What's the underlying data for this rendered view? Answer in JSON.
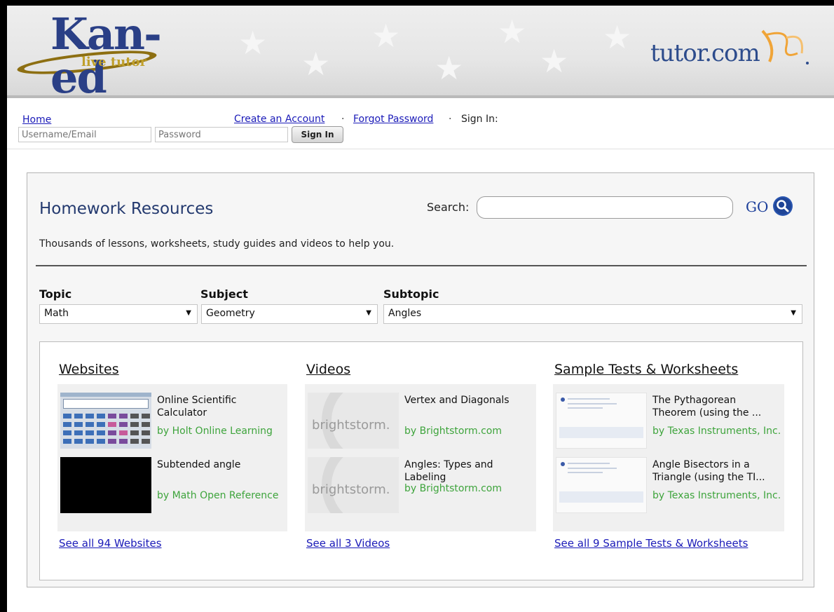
{
  "header": {
    "kaned_logo_text": "Kan-ed",
    "kaned_logo_sub": "live tutor",
    "tutor_logo_text": "tutor.com"
  },
  "login": {
    "home": "Home",
    "create_account": "Create an Account",
    "separator": "·",
    "forgot_password": "Forgot Password",
    "sign_in_label": "Sign In:",
    "username_placeholder": "Username/Email",
    "password_placeholder": "Password",
    "sign_in_button": "Sign In"
  },
  "homework": {
    "title": "Homework Resources",
    "description": "Thousands of lessons, worksheets, study guides and videos to help you.",
    "search_label": "Search:",
    "search_value": "",
    "go_label": "GO",
    "filters": {
      "topic_label": "Topic",
      "topic_value": "Math",
      "subject_label": "Subject",
      "subject_value": "Geometry",
      "subtopic_label": "Subtopic",
      "subtopic_value": "Angles"
    },
    "columns": [
      {
        "title": "Websites",
        "items": [
          {
            "title": "Online Scientific Calculator",
            "by": "by Holt Online Learning"
          },
          {
            "title": "Subtended angle",
            "by": "by Math Open Reference"
          }
        ],
        "see_all": "See all 94 Websites"
      },
      {
        "title": "Videos",
        "items": [
          {
            "title": "Vertex and Diagonals",
            "by": "by Brightstorm.com",
            "thumb_text": "brightstorm."
          },
          {
            "title": "Angles: Types and Labeling",
            "by": "by Brightstorm.com",
            "thumb_text": "brightstorm."
          }
        ],
        "see_all": "See all 3 Videos"
      },
      {
        "title": "Sample Tests & Worksheets",
        "items": [
          {
            "title": "The Pythagorean Theorem (using the ...",
            "by": "by Texas Instruments, Inc."
          },
          {
            "title": "Angle Bisectors in a Triangle (using the TI...",
            "by": "by Texas Instruments, Inc."
          }
        ],
        "see_all": "See all 9 Sample Tests & Worksheets"
      }
    ]
  },
  "colors": {
    "link": "#1a1ab8",
    "title_blue": "#243a6f",
    "byline_green": "#3ea43c"
  },
  "icons": {
    "go": "search-magnifier-icon",
    "dropdown": "chevron-down-icon"
  }
}
